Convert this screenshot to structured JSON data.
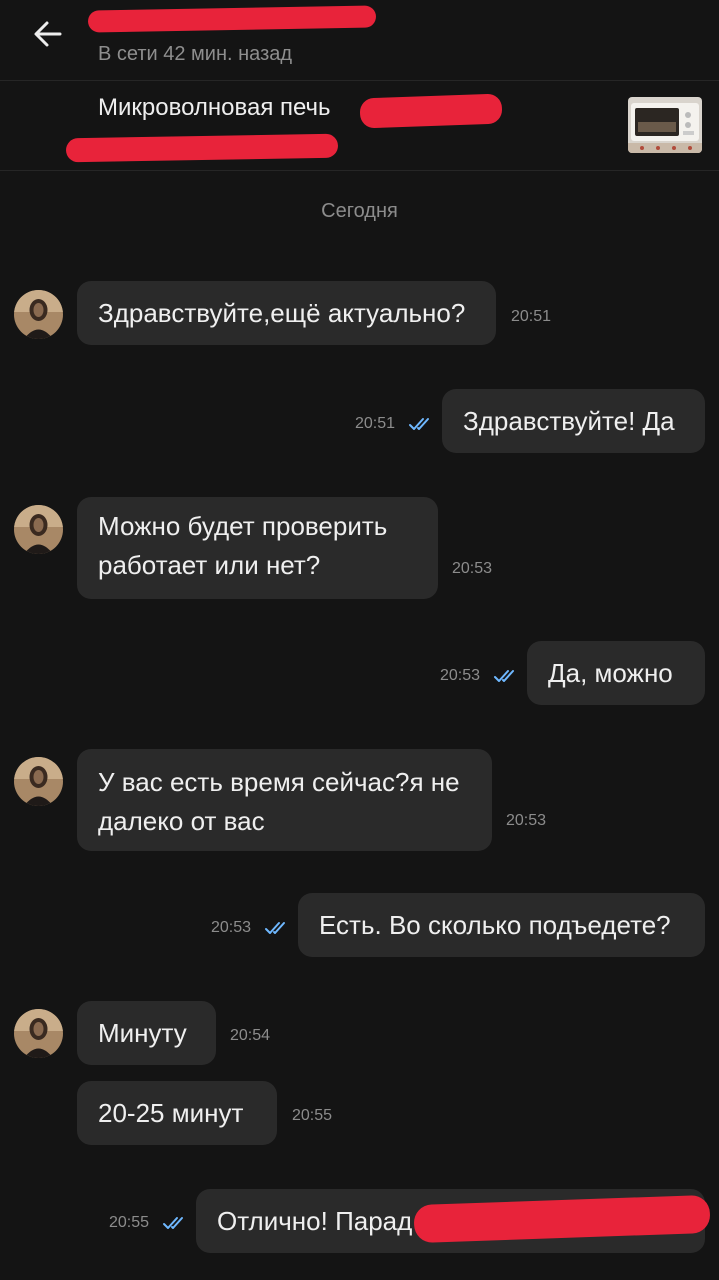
{
  "header": {
    "contact_name": "",
    "status": "В сети 42 мин. назад"
  },
  "ad": {
    "title": "Микроволновая печь"
  },
  "chat": {
    "date_label": "Сегодня",
    "messages": [
      {
        "text": "Здравствуйте,ещё актуально?",
        "time": "20:51",
        "direction": "incoming"
      },
      {
        "text": "Здравствуйте! Да",
        "time": "20:51",
        "direction": "outgoing",
        "read": true
      },
      {
        "text_lines": [
          "Можно будет проверить",
          "работает или нет?"
        ],
        "time": "20:53",
        "direction": "incoming"
      },
      {
        "text": "Да, можно",
        "time": "20:53",
        "direction": "outgoing",
        "read": true
      },
      {
        "text_lines": [
          "У вас есть время сейчас?я не",
          "далеко от вас"
        ],
        "time": "20:53",
        "direction": "incoming"
      },
      {
        "text": "Есть. Во сколько подъедете?",
        "time": "20:53",
        "direction": "outgoing",
        "read": true
      },
      {
        "text": "Минуту",
        "time": "20:54",
        "direction": "incoming"
      },
      {
        "text": "20-25 минут",
        "time": "20:55",
        "direction": "incoming"
      },
      {
        "text": "Отлично! Парад",
        "time": "20:55",
        "direction": "outgoing",
        "read": true
      }
    ]
  },
  "colors": {
    "background": "#141414",
    "bubble": "#2a2a2a",
    "read_ticks": "#6fb8ff",
    "redaction": "#e8233a"
  }
}
